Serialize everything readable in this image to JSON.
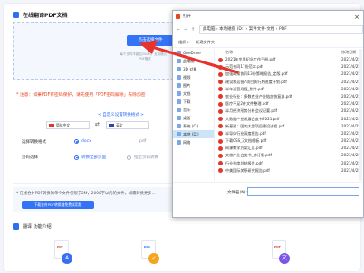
{
  "upload": {
    "section_title": "在线翻译PDF文档",
    "button": "点击选择文件",
    "hint_line1": "每个文件不超过200M，支持格式：",
    "hint_line2": "PDF格式"
  },
  "notice": "* 注意：如果PDF有密码保护，请先使用「PDF密码解除」去除加密",
  "swap_link": "< 自定义设置转换格式 >",
  "language": {
    "from": "简体中文",
    "to": "英文"
  },
  "format": {
    "label": "选择转换格式",
    "opt_docx": "docx",
    "opt_pdf": "pdf"
  },
  "pages": {
    "label": "页码选择",
    "opt_all": "转换全部页面",
    "opt_range": "指定页码转换"
  },
  "bottom": {
    "text": "* 在线合并PDF转换的单个文件仅限于2M，2000字以内的文件，如需转换更多...",
    "button": "下载金舟PDF转换器免费试用版"
  },
  "features": {
    "title": "翻译 功能介绍",
    "icon1": "PDF",
    "icon2": "DOC",
    "icon3": "PDF"
  },
  "dialog": {
    "title": "打开",
    "path": "此电脑 › 本地磁盘 (D:) › 案件文件-文档 › PDF",
    "organize": "组织 ▾",
    "new_folder": "新建文件夹",
    "col_name": "名称",
    "col_date": "修改日期",
    "tree": [
      "OneDrive",
      "此电脑",
      "3D 对象",
      "视频",
      "图片",
      "文档",
      "下载",
      "音乐",
      "桌面",
      "系统 (C:)",
      "本地 (D:)",
      "网络"
    ],
    "files": [
      {
        "name": "2021年冬奥纪念工作手册.pdf",
        "date": "2021/4/25"
      },
      {
        "name": "示范合同17份范本.pdf",
        "date": "2021/4/25"
      },
      {
        "name": "加强政策协同13份策略报告_定版.pdf",
        "date": "2021/4/25"
      },
      {
        "name": "建设和运营7项目执行期进度计划.pdf",
        "date": "2021/4/25"
      },
      {
        "name": "半年运营月报_附件.pdf",
        "date": "2021/4/25"
      },
      {
        "name": "农业行业：多数农业产业链加快复苏.pdf",
        "date": "2021/4/25"
      },
      {
        "name": "医疗不足2件文件整理.pdf",
        "date": "2021/4/25"
      },
      {
        "name": "半月经济形势分析会议纪要.pdf",
        "date": "2021/4/25"
      },
      {
        "name": "大数据产业发展白皮书2021.pdf",
        "date": "2021/4/25"
      },
      {
        "name": "新基建：国内大型项目建设进程.pdf",
        "date": "2021/4/25"
      },
      {
        "name": "半导体行业深度报告.pdf",
        "date": "2021/4/25"
      },
      {
        "name": "下载CSS_3文档模板.pdf",
        "date": "2021/4/25"
      },
      {
        "name": "网课教学方案汇总.pdf",
        "date": "2021/4/25"
      },
      {
        "name": "文旅产业白皮书_修订版.pdf",
        "date": "2021/4/25"
      },
      {
        "name": "行业季度总结报告.pdf",
        "date": "2021/4/25"
      },
      {
        "name": "中美国际关系研究报告.pdf",
        "date": "2021/4/25"
      }
    ],
    "filename_label": "文件名(N):"
  }
}
